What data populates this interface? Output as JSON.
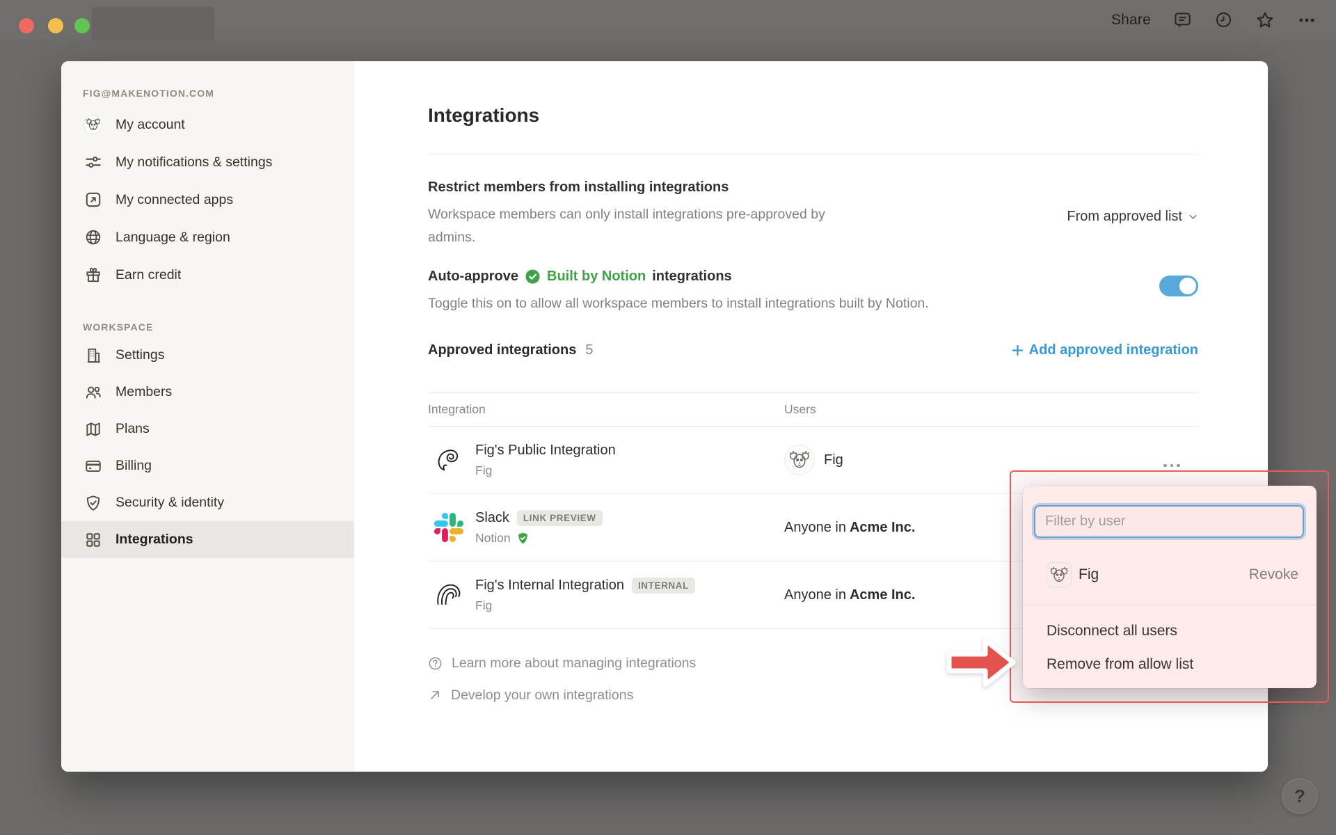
{
  "titlebar": {
    "share_label": "Share",
    "icons": [
      "comment-icon",
      "history-icon",
      "star-icon",
      "more-icon"
    ]
  },
  "sidebar": {
    "account_header": "FIG@MAKENOTION.COM",
    "account_items": [
      {
        "label": "My account",
        "icon": "avatar-koala"
      },
      {
        "label": "My notifications & settings",
        "icon": "sliders-icon"
      },
      {
        "label": "My connected apps",
        "icon": "external-link-icon"
      },
      {
        "label": "Language & region",
        "icon": "globe-icon"
      },
      {
        "label": "Earn credit",
        "icon": "gift-icon"
      }
    ],
    "workspace_header": "WORKSPACE",
    "workspace_items": [
      {
        "label": "Settings",
        "icon": "building-icon"
      },
      {
        "label": "Members",
        "icon": "people-icon"
      },
      {
        "label": "Plans",
        "icon": "map-icon"
      },
      {
        "label": "Billing",
        "icon": "credit-card-icon"
      },
      {
        "label": "Security & identity",
        "icon": "shield-check-icon"
      },
      {
        "label": "Integrations",
        "icon": "grid-icon",
        "active": true
      }
    ]
  },
  "main": {
    "title": "Integrations",
    "restrict": {
      "title": "Restrict members from installing integrations",
      "description": "Workspace members can only install integrations pre-approved by admins.",
      "dropdown_value": "From approved list"
    },
    "auto_approve": {
      "prefix": "Auto-approve",
      "badge_label": "Built by Notion",
      "suffix": "integrations",
      "description": "Toggle this on to allow all workspace members to install integrations built by Notion.",
      "toggle_state": "on"
    },
    "approved": {
      "title": "Approved integrations",
      "count": "5",
      "add_label": "Add approved integration"
    },
    "table": {
      "columns": [
        "Integration",
        "Users"
      ],
      "rows": [
        {
          "name": "Fig's Public Integration",
          "subtitle": "Fig",
          "users_name": "Fig",
          "icon": "scribble-doodle"
        },
        {
          "name": "Slack",
          "badge": "LINK PREVIEW",
          "subtitle": "Notion",
          "verified": true,
          "users_prefix": "Anyone in",
          "users_org": "Acme Inc.",
          "icon": "slack-logo"
        },
        {
          "name": "Fig's Internal Integration",
          "badge": "INTERNAL",
          "subtitle": "Fig",
          "users_prefix": "Anyone in",
          "users_org": "Acme Inc.",
          "icon": "arcs-doodle"
        }
      ]
    },
    "footer_links": [
      {
        "label": "Learn more about managing integrations",
        "icon": "question-circle-icon"
      },
      {
        "label": "Develop your own integrations",
        "icon": "arrow-up-right-icon"
      }
    ]
  },
  "popup": {
    "filter_placeholder": "Filter by user",
    "user": {
      "name": "Fig",
      "action": "Revoke"
    },
    "menu_items": [
      "Disconnect all users",
      "Remove from allow list"
    ]
  },
  "help_button_label": "?",
  "colors": {
    "accent_blue": "#3599d6",
    "toggle_blue": "#58a8da",
    "builtby_green": "#3fa246",
    "annotation_red": "#e05d58",
    "backdrop_gray": "#6c6b6a"
  }
}
